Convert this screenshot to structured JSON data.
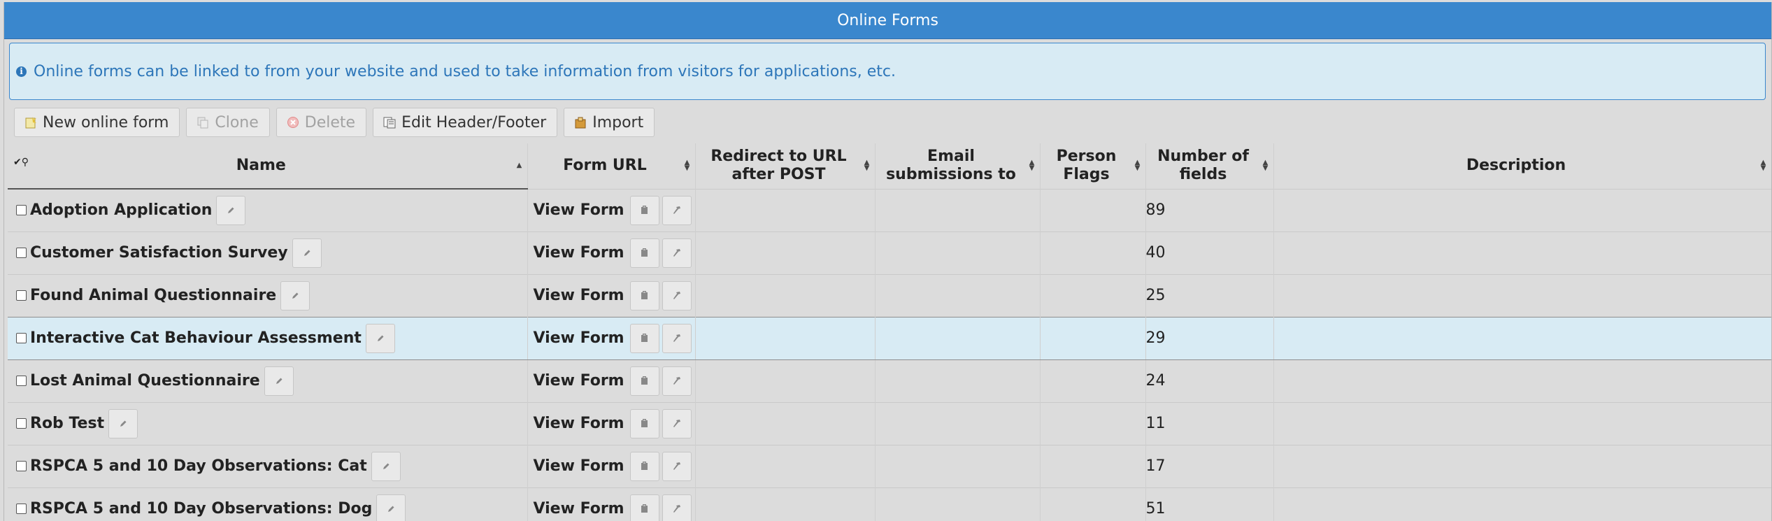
{
  "window": {
    "title": "Online Forms"
  },
  "info": {
    "text": "Online forms can be linked to from your website and used to take information from visitors for applications, etc."
  },
  "toolbar": {
    "new_label": "New online form",
    "clone_label": "Clone",
    "delete_label": "Delete",
    "edit_header_label": "Edit Header/Footer",
    "import_label": "Import"
  },
  "columns": {
    "name": "Name",
    "form_url": "Form URL",
    "redirect": "Redirect to URL after POST",
    "email": "Email submissions to",
    "flags": "Person Flags",
    "fields": "Number of fields",
    "description": "Description"
  },
  "rows": [
    {
      "name": "Adoption Application",
      "view": "View Form",
      "redirect": "",
      "email": "",
      "flags": "",
      "fields": "89",
      "description": ""
    },
    {
      "name": "Customer Satisfaction Survey",
      "view": "View Form",
      "redirect": "",
      "email": "",
      "flags": "",
      "fields": "40",
      "description": ""
    },
    {
      "name": "Found Animal Questionnaire",
      "view": "View Form",
      "redirect": "",
      "email": "",
      "flags": "",
      "fields": "25",
      "description": ""
    },
    {
      "name": "Interactive Cat Behaviour Assessment",
      "view": "View Form",
      "redirect": "",
      "email": "",
      "flags": "",
      "fields": "29",
      "description": ""
    },
    {
      "name": "Lost Animal Questionnaire",
      "view": "View Form",
      "redirect": "",
      "email": "",
      "flags": "",
      "fields": "24",
      "description": ""
    },
    {
      "name": "Rob Test",
      "view": "View Form",
      "redirect": "",
      "email": "",
      "flags": "",
      "fields": "11",
      "description": ""
    },
    {
      "name": "RSPCA 5 and 10 Day Observations: Cat",
      "view": "View Form",
      "redirect": "",
      "email": "",
      "flags": "",
      "fields": "17",
      "description": ""
    },
    {
      "name": "RSPCA 5 and 10 Day Observations: Dog",
      "view": "View Form",
      "redirect": "",
      "email": "",
      "flags": "",
      "fields": "51",
      "description": ""
    }
  ],
  "colors": {
    "titlebar": "#3a87cd",
    "info_bg": "#d8ebf4",
    "info_text": "#2d76b9",
    "highlight_row": "#d8ebf4"
  }
}
